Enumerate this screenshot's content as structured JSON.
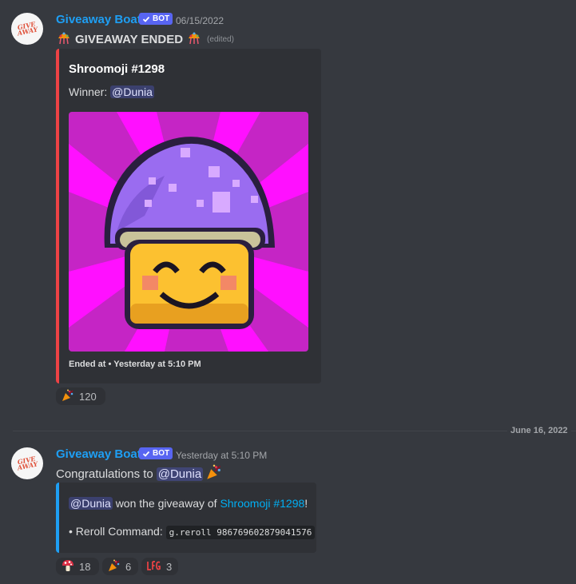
{
  "message1": {
    "author": "Giveaway Boat",
    "bot_tag": "BOT",
    "timestamp": "06/15/2022",
    "content": "GIVEAWAY ENDED",
    "edited": "(edited)",
    "embed": {
      "title": "Shroomoji #1298",
      "winner_label": "Winner:",
      "winner_mention": "@Dunia",
      "footer": "Ended at • Yesterday at 5:10 PM",
      "accent_color": "#ed4245"
    },
    "reaction": {
      "emoji": "party-popper",
      "count": "120"
    }
  },
  "divider": {
    "date": "June 16, 2022"
  },
  "message2": {
    "author": "Giveaway Boat",
    "bot_tag": "BOT",
    "timestamp": "Yesterday at 5:10 PM",
    "content_prefix": "Congratulations to",
    "mention": "@Dunia",
    "embed": {
      "mention": "@Dunia",
      "won_text": "won the giveaway of",
      "link_text": "Shroomoji #1298",
      "exclaim": "!",
      "reroll_label": "• Reroll Command:",
      "reroll_code": "g.reroll 986769602879041576",
      "accent_color": "#1e9ff4"
    },
    "reactions": [
      {
        "emoji": "mushroom",
        "count": "18"
      },
      {
        "emoji": "party-popper",
        "count": "6"
      },
      {
        "emoji": "lfg-text",
        "count": "3"
      }
    ]
  },
  "avatar_text": "GIVE AWAY"
}
